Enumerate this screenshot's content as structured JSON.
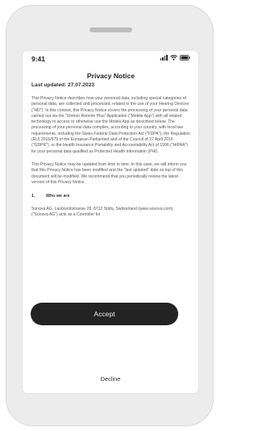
{
  "status_bar": {
    "time": "9:41",
    "icons": [
      "cellular-signal-icon",
      "wifi-icon",
      "battery-icon"
    ]
  },
  "privacy": {
    "title": "Privacy Notice",
    "last_updated": "Last updated: 27.07.2023",
    "paragraph_1": "This Privacy Notice describes how your personal data, including special categories of personal data, are collected and processed, related to the use of your Hearing Devices (\"HD\"). In this context, this Privacy Notice covers the processing of your personal data carried out via the \"Unitron Remote Plus\" Application (\"Mobile App\") with all related technology to access or otherwise use the Mobile App as described below. The processing of your personal data complies, according to your country, with local law requirements, including the Swiss Federal Data Protection Act (\"FDPA\"), the Regulation (EU) 2016/679 of the European Parliament and of the Council of 27 April 2016 (\"GDPR\"), or the Health Insurance Portability and Accountability Act of 1996 (\"HIPAA\") for your personal data qualified as Protected Health Information (PHI).",
    "paragraph_2": "This Privacy Notice may be updated from time to time. In this case, we will inform you that this Privacy Notice has been modified and the \"last updated\" date on top of this document will be modified. We recommend that you periodically review the latest version of this Privacy Notice.",
    "section_number": "1.",
    "section_title": "Who we are",
    "paragraph_3": "Sonova AG, Laubisrütistrasse 28, 8712 Stäfa, Switzerland (www.sonova.com), (\"Sonova AG\") acts as a Controller for"
  },
  "actions": {
    "accept_label": "Accept",
    "decline_label": "Decline"
  }
}
